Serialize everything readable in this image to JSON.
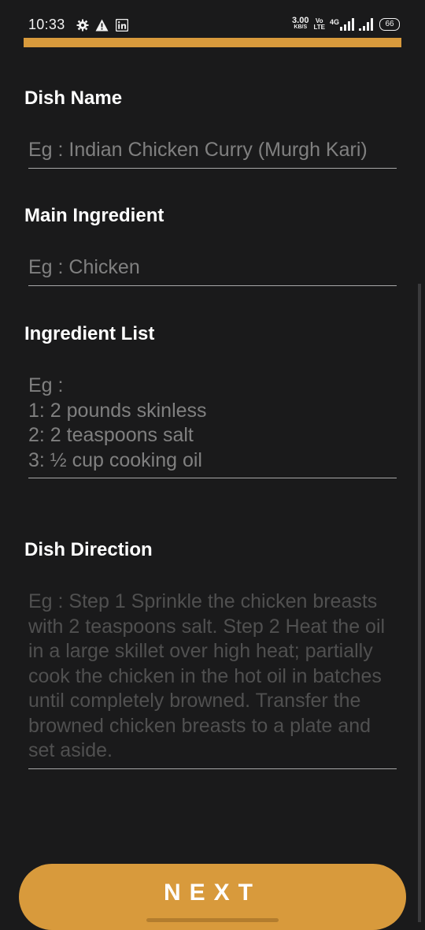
{
  "status_bar": {
    "time": "10:33",
    "left_icons": [
      "gear-icon",
      "warning-icon",
      "linkedin-icon"
    ],
    "net_speed_value": "3.00",
    "net_speed_unit": "KB/S",
    "volte_top": "Vo",
    "volte_bottom": "LTE",
    "network_type": "4G",
    "battery": "66"
  },
  "theme": {
    "accent": "#d89a3c",
    "background": "#1a1a1b"
  },
  "form": {
    "dish_name": {
      "label": "Dish Name",
      "placeholder": "Eg : Indian Chicken Curry (Murgh Kari)"
    },
    "main_ingredient": {
      "label": "Main Ingredient",
      "placeholder": "Eg : Chicken"
    },
    "ingredient_list": {
      "label": "Ingredient List",
      "placeholder": "Eg :\n1: 2 pounds skinless\n2: 2 teaspoons salt\n3: ½ cup cooking oil"
    },
    "dish_direction": {
      "label": "Dish Direction",
      "placeholder": "Eg : Step 1 Sprinkle the chicken breasts with 2 teaspoons salt. Step 2 Heat the oil in a large skillet over high heat; partially cook the chicken in the hot oil in batches until completely browned. Transfer the browned chicken breasts to a plate and set aside."
    }
  },
  "next_button": {
    "label": "NEXT"
  }
}
